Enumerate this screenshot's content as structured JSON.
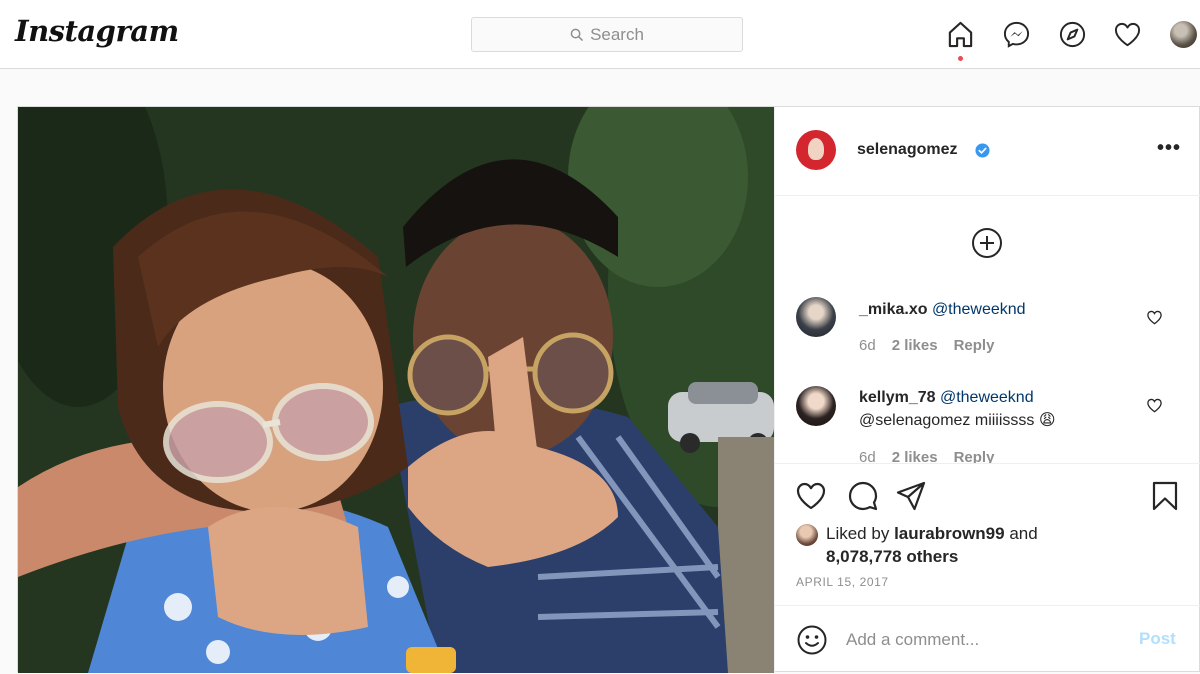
{
  "app": {
    "logo_text": "Instagram"
  },
  "search": {
    "placeholder": "Search"
  },
  "nav": {
    "icons": [
      "home-icon",
      "messenger-icon",
      "explore-icon",
      "activity-heart-icon",
      "profile-avatar"
    ],
    "active": "home",
    "notification_dot_color": "#ed4956"
  },
  "post": {
    "author": {
      "username": "selenagomez",
      "verified": true
    },
    "more_label": "•••",
    "comments": [
      {
        "username": "_mika.xo",
        "mention": "@theweeknd",
        "text": "",
        "age": "6d",
        "likes": "2 likes",
        "reply_label": "Reply"
      },
      {
        "username": "kellym_78",
        "mention": "@theweeknd",
        "text": "@selenagomez miiiissss 😩",
        "age": "6d",
        "likes": "2 likes",
        "reply_label": "Reply"
      }
    ],
    "liked_by": {
      "prefix": "Liked by",
      "user": "laurabrown99",
      "suffix": "and",
      "others": "8,078,778 others"
    },
    "date": "APRIL 15, 2017",
    "add_comment": {
      "placeholder": "Add a comment...",
      "post_label": "Post"
    }
  },
  "colors": {
    "link_blue": "#00376b",
    "post_button_disabled": "#b2dffc",
    "verified_badge": "#3897f0",
    "meta_gray": "#8e8e8e"
  }
}
